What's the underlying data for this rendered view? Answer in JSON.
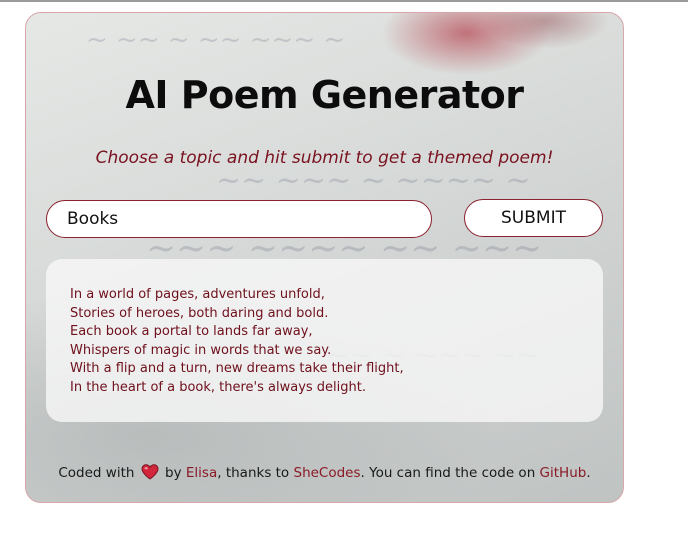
{
  "app": {
    "title": "AI Poem Generator",
    "subtitle": "Choose a topic and hit submit to get a themed poem!"
  },
  "form": {
    "input_value": "Books",
    "submit_label": "SUBMIT"
  },
  "poem": {
    "lines": [
      "In a world of pages, adventures unfold,",
      "Stories of heroes, both daring and bold.",
      "Each book a portal to lands far away,",
      "Whispers of magic in words that we say.",
      "With a flip and a turn, new dreams take their flight,",
      "In the heart of a book, there's always delight."
    ]
  },
  "footer": {
    "prefix": "Coded with",
    "heart_icon": "heart-icon",
    "by_text": "by",
    "author_link": "Elisa",
    "thanks_text": ", thanks to",
    "shecodes_link": "SheCodes",
    "code_text": ". You can find the code on",
    "github_link": "GitHub",
    "suffix": "."
  },
  "colors": {
    "accent": "#7a1220",
    "border": "#8a2230",
    "heart": "#d2263c"
  }
}
